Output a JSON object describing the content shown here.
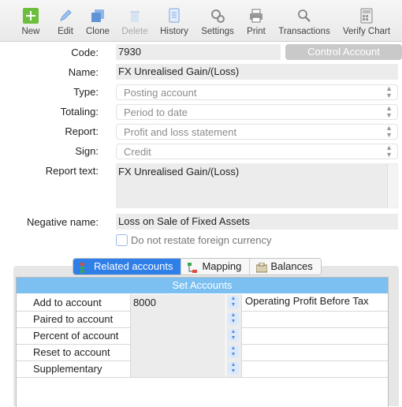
{
  "toolbar": {
    "new": "New",
    "edit": "Edit",
    "clone": "Clone",
    "delete": "Delete",
    "history": "History",
    "settings": "Settings",
    "print": "Print",
    "transactions": "Transactions",
    "verify_chart": "Verify Chart"
  },
  "form": {
    "code_label": "Code:",
    "code_value": "7930",
    "control_account_button": "Control Account",
    "name_label": "Name:",
    "name_value": "FX Unrealised Gain/(Loss)",
    "type_label": "Type:",
    "type_value": "Posting account",
    "totaling_label": "Totaling:",
    "totaling_value": "Period to date",
    "report_label": "Report:",
    "report_value": "Profit and loss statement",
    "sign_label": "Sign:",
    "sign_value": "Credit",
    "report_text_label": "Report text:",
    "report_text_value": "FX Unrealised Gain/(Loss)",
    "negative_name_label": "Negative name:",
    "negative_name_value": "Loss on Sale of Fixed Assets",
    "restate_checkbox_label": "Do not restate foreign currency",
    "restate_checked": false
  },
  "tabs": {
    "related": "Related accounts",
    "mapping": "Mapping",
    "balances": "Balances",
    "active": "related"
  },
  "set_accounts": {
    "title": "Set Accounts",
    "rows": [
      {
        "label": "Add to account",
        "code": "8000",
        "description": "Operating Profit Before Tax"
      },
      {
        "label": "Paired to account",
        "code": "",
        "description": ""
      },
      {
        "label": "Percent of account",
        "code": "",
        "description": ""
      },
      {
        "label": "Reset to account",
        "code": "",
        "description": ""
      },
      {
        "label": "Supplementary",
        "code": "",
        "description": ""
      }
    ]
  },
  "colors": {
    "accent": "#2f7fe9",
    "header_blue": "#7cc0f2",
    "new_green": "#6cbf3c"
  }
}
